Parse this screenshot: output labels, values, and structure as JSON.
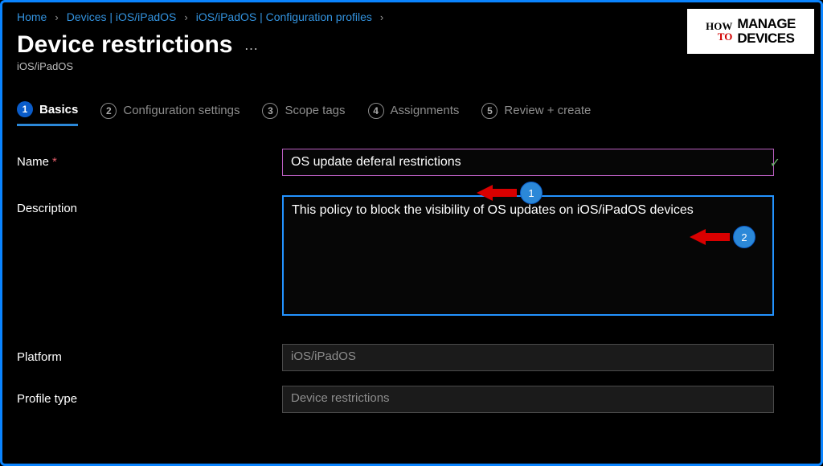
{
  "breadcrumb": {
    "items": [
      "Home",
      "Devices | iOS/iPadOS",
      "iOS/iPadOS | Configuration profiles"
    ]
  },
  "header": {
    "title": "Device restrictions",
    "more": "…",
    "subtitle": "iOS/iPadOS"
  },
  "tabs": [
    {
      "num": "1",
      "label": "Basics"
    },
    {
      "num": "2",
      "label": "Configuration settings"
    },
    {
      "num": "3",
      "label": "Scope tags"
    },
    {
      "num": "4",
      "label": "Assignments"
    },
    {
      "num": "5",
      "label": "Review + create"
    }
  ],
  "form": {
    "name_label": "Name",
    "name_value": "OS update deferal restrictions",
    "desc_label": "Description",
    "desc_value": "This policy to block the visibility of OS updates on iOS/iPadOS devices",
    "platform_label": "Platform",
    "platform_value": "iOS/iPadOS",
    "profile_label": "Profile type",
    "profile_value": "Device restrictions"
  },
  "annotations": {
    "a1": "1",
    "a2": "2"
  },
  "logo": {
    "how": "HOW",
    "to": "TO",
    "line1": "MANAGE",
    "line2": "DEVICES"
  }
}
